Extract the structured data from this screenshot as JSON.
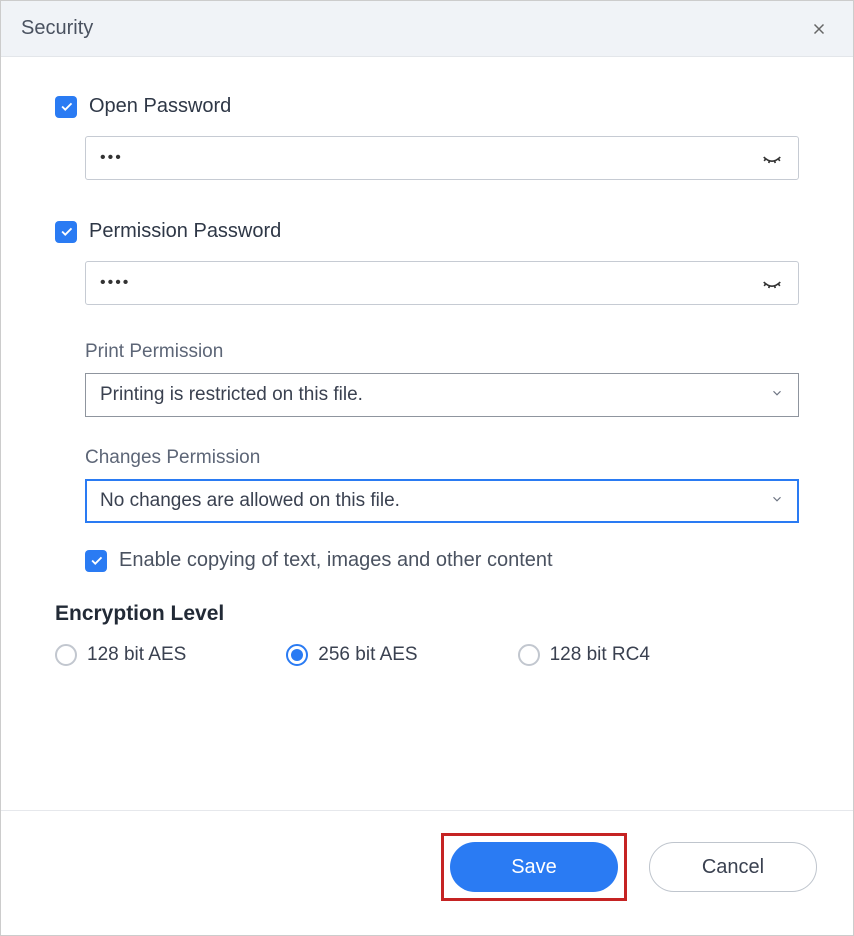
{
  "dialog": {
    "title": "Security"
  },
  "openPassword": {
    "label": "Open Password",
    "checked": true,
    "mask": "•••"
  },
  "permissionPassword": {
    "label": "Permission Password",
    "checked": true,
    "mask": "••••"
  },
  "printPermission": {
    "label": "Print Permission",
    "value": "Printing is restricted on this file."
  },
  "changesPermission": {
    "label": "Changes Permission",
    "value": "No changes are allowed on this file."
  },
  "enableCopy": {
    "label": "Enable copying of text, images and other content",
    "checked": true
  },
  "encryption": {
    "title": "Encryption Level",
    "options": [
      {
        "label": "128 bit AES",
        "selected": false
      },
      {
        "label": "256 bit AES",
        "selected": true
      },
      {
        "label": "128 bit RC4",
        "selected": false
      }
    ]
  },
  "buttons": {
    "save": "Save",
    "cancel": "Cancel"
  }
}
